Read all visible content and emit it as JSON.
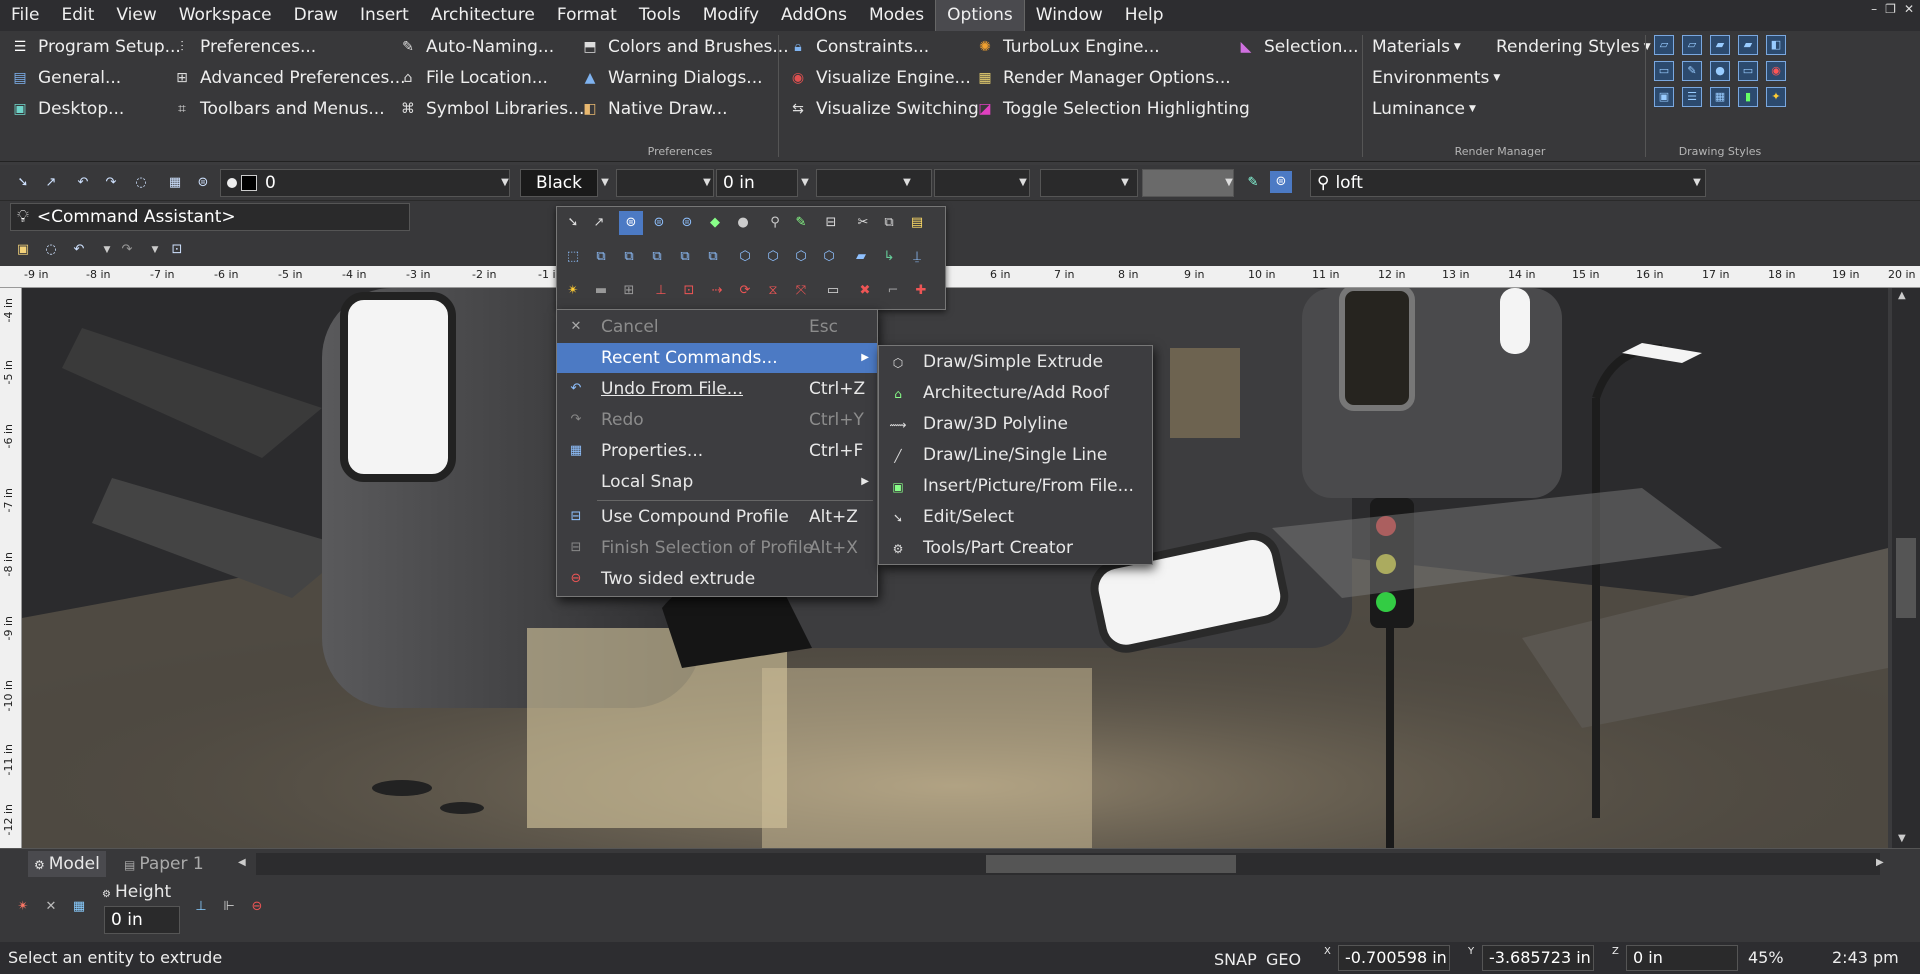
{
  "menubar": {
    "items": [
      "File",
      "Edit",
      "View",
      "Workspace",
      "Draw",
      "Insert",
      "Architecture",
      "Format",
      "Tools",
      "Modify",
      "AddOns",
      "Modes",
      "Options",
      "Window",
      "Help"
    ],
    "active": "Options",
    "window_controls": [
      "–",
      "❐",
      "✕"
    ]
  },
  "ribbon": {
    "col1": [
      "Program Setup...",
      "General...",
      "Desktop..."
    ],
    "col2": [
      "Preferences...",
      "Advanced Preferences...",
      "Toolbars and Menus..."
    ],
    "col3": [
      "Auto-Naming...",
      "File Location...",
      "Symbol Libraries..."
    ],
    "col4": [
      "Colors and Brushes...",
      "Warning Dialogs...",
      "Native Draw..."
    ],
    "col5": [
      "Constraints...",
      "Visualize Engine...",
      "Visualize Switching"
    ],
    "col6": [
      "TurboLux Engine...",
      "Render Manager Options...",
      "Toggle Selection Highlighting"
    ],
    "col7": [
      "Selection..."
    ],
    "col8": [
      "Materials",
      "Environments",
      "Luminance"
    ],
    "col9": [
      "Rendering Styles"
    ],
    "groups": {
      "preferences": "Preferences",
      "render_manager": "Render Manager",
      "drawing_styles": "Drawing Styles"
    }
  },
  "propbar": {
    "layer_value": "0",
    "color_value": "Black",
    "width_value": "0 in",
    "search_value": "loft"
  },
  "command_assistant": "<Command Assistant>",
  "ruler": {
    "h_ticks": [
      "-9 in",
      "-8 in",
      "-7 in",
      "-6 in",
      "-5 in",
      "-4 in",
      "-3 in",
      "-2 in",
      "-1 i",
      "6 in",
      "7 in",
      "8 in",
      "9 in",
      "10 in",
      "11 in",
      "12 in",
      "13 in",
      "14 in",
      "15 in",
      "16 in",
      "17 in",
      "18 in",
      "19 in",
      "20 in"
    ],
    "v_ticks": [
      "-4 in",
      "-5 in",
      "-6 in",
      "-7 in",
      "-8 in",
      "-9 in",
      "-10 in",
      "-11 in",
      "-12 in"
    ]
  },
  "context_menu": {
    "items": [
      {
        "label": "Cancel",
        "shortcut": "Esc",
        "disabled": true,
        "icon": "close-icon"
      },
      {
        "label": "Recent Commands...",
        "shortcut": "",
        "disabled": false,
        "highlighted": true,
        "submenu": true,
        "icon": ""
      },
      {
        "label": "Undo From File...",
        "shortcut": "Ctrl+Z",
        "disabled": false,
        "icon": "undo-icon"
      },
      {
        "label": "Redo",
        "shortcut": "Ctrl+Y",
        "disabled": true,
        "icon": "redo-icon"
      },
      {
        "label": "Properties...",
        "shortcut": "Ctrl+F",
        "disabled": false,
        "icon": "properties-icon"
      },
      {
        "label": "Local Snap",
        "shortcut": "",
        "disabled": false,
        "submenu": true,
        "icon": ""
      },
      {
        "label": "Use Compound Profile",
        "shortcut": "Alt+Z",
        "disabled": false,
        "icon": "compound-profile-icon"
      },
      {
        "label": "Finish Selection of Profile",
        "shortcut": "Alt+X",
        "disabled": true,
        "icon": "finish-profile-icon"
      },
      {
        "label": "Two sided extrude",
        "shortcut": "",
        "disabled": false,
        "icon": "two-sided-extrude-icon"
      }
    ]
  },
  "submenu": {
    "items": [
      "Draw/Simple Extrude",
      "Architecture/Add Roof",
      "Draw/3D Polyline",
      "Draw/Line/Single Line",
      "Insert/Picture/From File...",
      "Edit/Select",
      "Tools/Part Creator"
    ]
  },
  "tabs": {
    "model": "Model",
    "paper": "Paper 1"
  },
  "tool_options": {
    "height_label": "Height",
    "height_value": "0 in"
  },
  "status": {
    "prompt": "Select an entity to extrude",
    "snap": "SNAP",
    "geo": "GEO",
    "x_label": "X",
    "x": "-0.700598 in",
    "y_label": "Y",
    "y": "-3.685723 in",
    "z_label": "Z",
    "z": "0 in",
    "zoom": "45%",
    "time": "2:43 pm"
  },
  "colors": {
    "accent": "#4c7ac4",
    "menubar": "#2d2d30",
    "panel": "#38383a"
  }
}
